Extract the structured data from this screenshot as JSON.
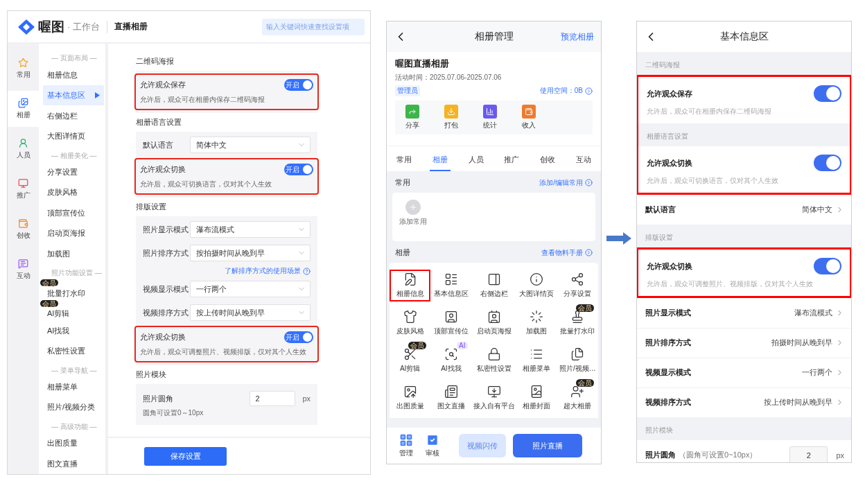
{
  "desktop": {
    "brand": "喔图",
    "brand_suffix": "· 工作台",
    "page_title": "直播相册",
    "search": {
      "placeholder": "输入关键词快速查找设置项"
    },
    "rail": [
      {
        "label": "常用",
        "selected": false
      },
      {
        "label": "相册",
        "selected": true
      },
      {
        "label": "人员",
        "selected": false
      },
      {
        "label": "推广",
        "selected": false
      },
      {
        "label": "创收",
        "selected": false
      },
      {
        "label": "互动",
        "selected": false
      }
    ],
    "menu": [
      {
        "kind": "heading",
        "label": "— 页面布局 —"
      },
      {
        "kind": "item",
        "label": "相册信息",
        "selected": false
      },
      {
        "kind": "item",
        "label": "基本信息区",
        "selected": true
      },
      {
        "kind": "item",
        "label": "右侧边栏",
        "selected": false
      },
      {
        "kind": "item",
        "label": "大图详情页",
        "selected": false
      },
      {
        "kind": "heading",
        "label": "— 相册美化 —"
      },
      {
        "kind": "item",
        "label": "分享设置",
        "selected": false
      },
      {
        "kind": "item",
        "label": "皮肤风格",
        "selected": false
      },
      {
        "kind": "item",
        "label": "顶部宣传位",
        "selected": false
      },
      {
        "kind": "item",
        "label": "启动页海报",
        "selected": false
      },
      {
        "kind": "item",
        "label": "加载图",
        "selected": false
      },
      {
        "kind": "heading",
        "label": "照片功能设置 —"
      },
      {
        "kind": "item",
        "label": "批量打水印",
        "selected": false,
        "badge": "会员"
      },
      {
        "kind": "item",
        "label": "AI剪辑",
        "selected": false,
        "badge": "会员"
      },
      {
        "kind": "item",
        "label": "AI找我",
        "selected": false
      },
      {
        "kind": "item",
        "label": "私密性设置",
        "selected": false
      },
      {
        "kind": "heading",
        "label": "— 菜单导航 —"
      },
      {
        "kind": "item",
        "label": "相册菜单",
        "selected": false
      },
      {
        "kind": "item",
        "label": "照片/视频分类",
        "selected": false
      },
      {
        "kind": "heading",
        "label": "— 高级功能 —"
      },
      {
        "kind": "item",
        "label": "出图质量",
        "selected": false
      },
      {
        "kind": "item",
        "label": "图文直播",
        "selected": false
      }
    ],
    "sections": [
      {
        "title": "二维码海报",
        "rows": [
          {
            "kind": "toggle",
            "label": "允许观众保存",
            "on": true,
            "state_text": "开启",
            "hint": "允许后，观众可在相册内保存二维码海报",
            "highlighted": true
          }
        ]
      },
      {
        "title": "相册语言设置",
        "rows": [
          {
            "kind": "select",
            "label": "默认语言",
            "value": "简体中文",
            "highlighted": false
          },
          {
            "kind": "toggle",
            "label": "允许观众切换",
            "on": true,
            "state_text": "开启",
            "hint": "允许后，观众可切换语言，仅对其个人生效",
            "highlighted": true
          }
        ]
      },
      {
        "title": "排版设置",
        "rows": [
          {
            "kind": "select",
            "label": "照片显示模式",
            "value": "瀑布流模式",
            "highlighted": false
          },
          {
            "kind": "select",
            "label": "照片排序方式",
            "value": "按拍摄时间从晚到早",
            "highlighted": false
          },
          {
            "kind": "link",
            "label": "了解排序方式的使用场景",
            "highlighted": false
          },
          {
            "kind": "select",
            "label": "视频显示模式",
            "value": "一行两个",
            "highlighted": false
          },
          {
            "kind": "select",
            "label": "视频排序方式",
            "value": "按上传时间从晚到早",
            "highlighted": false
          },
          {
            "kind": "toggle",
            "label": "允许观众切换",
            "on": true,
            "state_text": "开启",
            "hint": "允许后，观众可调整照片、视频排版，仅对其个人生效",
            "highlighted": true
          }
        ]
      },
      {
        "title": "照片模块",
        "rows": [
          {
            "kind": "number",
            "label": "照片圆角",
            "value": "2",
            "unit": "px",
            "hint": "圆角可设置0～10px",
            "highlighted": false
          }
        ]
      }
    ],
    "save_button": "保存设置"
  },
  "manage": {
    "title": "相册管理",
    "action": "预览相册",
    "album_name": "喔图直播相册",
    "activity_time": "活动时间：2025.07.06-2025.07.06",
    "role": "管理员",
    "storage": "使用空间：0B",
    "quick_actions": [
      "分享",
      "打包",
      "统计",
      "收入"
    ],
    "tabs": [
      {
        "label": "常用",
        "selected": false
      },
      {
        "label": "相册",
        "selected": true
      },
      {
        "label": "人员",
        "selected": false
      },
      {
        "label": "推广",
        "selected": false
      },
      {
        "label": "创收",
        "selected": false
      },
      {
        "label": "互动",
        "selected": false
      }
    ],
    "favorites": {
      "title": "常用",
      "link": "添加/编辑常用",
      "add_label": "添加常用"
    },
    "album_tools": {
      "title": "相册",
      "link": "查看物料手册",
      "items": [
        {
          "label": "相册信息",
          "highlighted": true
        },
        {
          "label": "基本信息区",
          "highlighted": false
        },
        {
          "label": "右侧边栏",
          "highlighted": false
        },
        {
          "label": "大图详情页",
          "highlighted": false
        },
        {
          "label": "分享设置",
          "highlighted": false
        },
        {
          "label": "皮肤风格",
          "highlighted": false
        },
        {
          "label": "顶部宣传位",
          "highlighted": false
        },
        {
          "label": "启动页海报",
          "highlighted": false
        },
        {
          "label": "加载图",
          "highlighted": false
        },
        {
          "label": "批量打水印",
          "highlighted": false,
          "badge": {
            "text": "会员",
            "kind": "member"
          }
        },
        {
          "label": "AI剪辑",
          "highlighted": false,
          "badge": {
            "text": "会员",
            "kind": "member"
          }
        },
        {
          "label": "AI找我",
          "highlighted": false,
          "badge": {
            "text": "AI",
            "kind": "ai"
          }
        },
        {
          "label": "私密性设置",
          "highlighted": false
        },
        {
          "label": "相册菜单",
          "highlighted": false
        },
        {
          "label": "照片/视频…",
          "highlighted": false
        },
        {
          "label": "出图质量",
          "highlighted": false
        },
        {
          "label": "图文直播",
          "highlighted": false
        },
        {
          "label": "接入自有平台",
          "highlighted": false
        },
        {
          "label": "相册封面",
          "highlighted": false
        },
        {
          "label": "超大相册",
          "highlighted": false,
          "badge": {
            "text": "会员",
            "kind": "member"
          }
        }
      ]
    },
    "bottom": {
      "nav": [
        "管理",
        "审核"
      ],
      "secondary_button": "视频闪传",
      "primary_button": "照片直播"
    }
  },
  "basic": {
    "title": "基本信息区",
    "rows": [
      {
        "kind": "group",
        "label": "二维码海报",
        "highlighted": false
      },
      {
        "kind": "toggle",
        "label": "允许观众保存",
        "hint": "允许后，观众可在相册内保存二维码海报",
        "on": true,
        "highlighted": true
      },
      {
        "kind": "group",
        "label": "相册语言设置",
        "highlighted": true
      },
      {
        "kind": "toggle",
        "label": "允许观众切换",
        "hint": "允许后，观众可切换语言，仅对其个人生效",
        "on": true,
        "highlighted": true
      },
      {
        "kind": "value",
        "label": "默认语言",
        "value": "简体中文",
        "highlighted": false
      },
      {
        "kind": "group",
        "label": "排版设置",
        "highlighted": false
      },
      {
        "kind": "toggle",
        "label": "允许观众切换",
        "hint": "允许后，观众可调整照片、视频排版，仅对其个人生效",
        "on": true,
        "highlighted": true
      },
      {
        "kind": "value",
        "label": "照片显示模式",
        "value": "瀑布流模式",
        "highlighted": false
      },
      {
        "kind": "value",
        "label": "照片排序方式",
        "value": "拍摄时间从晚到早",
        "highlighted": false
      },
      {
        "kind": "value",
        "label": "视频显示模式",
        "value": "一行两个",
        "highlighted": false
      },
      {
        "kind": "value",
        "label": "视频排序方式",
        "value": "按上传时间从晚到早",
        "highlighted": false
      },
      {
        "kind": "group",
        "label": "照片模块",
        "highlighted": false
      },
      {
        "kind": "number",
        "label": "照片圆角",
        "note": "（圆角可设置0~10px）",
        "value": "2",
        "unit": "px",
        "highlighted": false
      }
    ]
  }
}
